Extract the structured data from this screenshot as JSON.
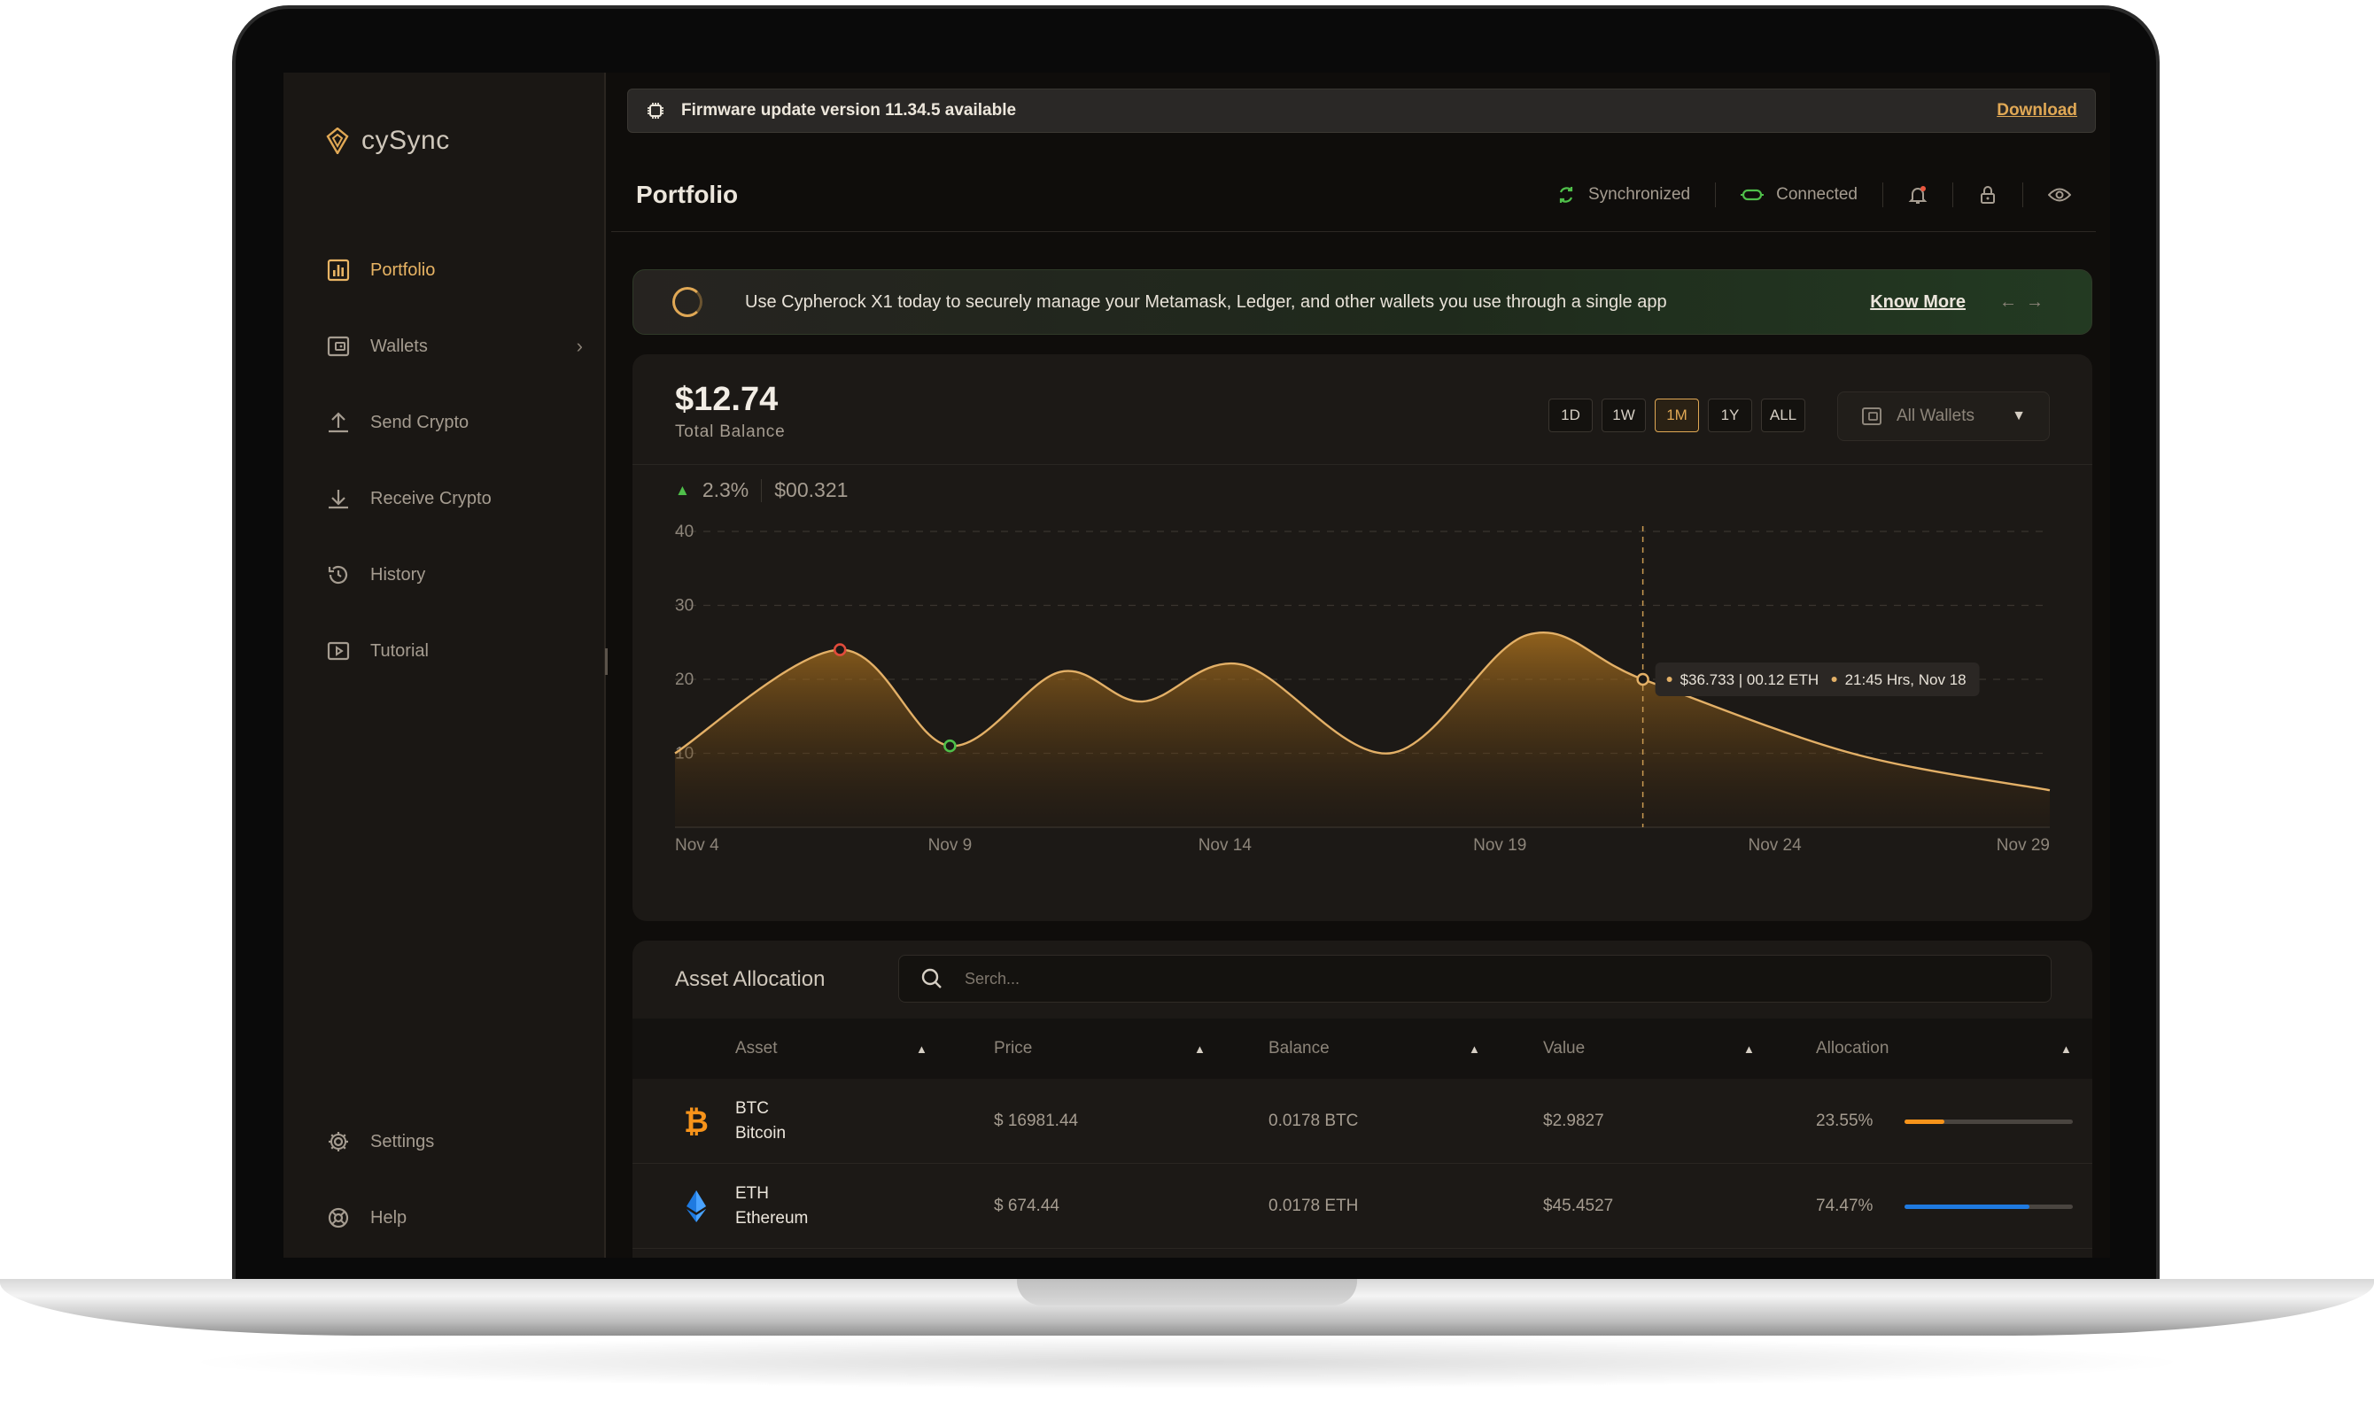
{
  "app": {
    "name": "cySync"
  },
  "sidebar": {
    "items": [
      {
        "label": "Portfolio",
        "icon": "portfolio-icon",
        "active": true
      },
      {
        "label": "Wallets",
        "icon": "wallet-icon",
        "has_submenu": true
      },
      {
        "label": "Send Crypto",
        "icon": "send-icon"
      },
      {
        "label": "Receive Crypto",
        "icon": "receive-icon"
      },
      {
        "label": "History",
        "icon": "history-icon"
      },
      {
        "label": "Tutorial",
        "icon": "tutorial-icon"
      }
    ],
    "bottom": [
      {
        "label": "Settings",
        "icon": "gear-icon"
      },
      {
        "label": "Help",
        "icon": "help-icon"
      }
    ]
  },
  "firmware": {
    "message": "Firmware update version 11.34.5 available",
    "action": "Download"
  },
  "header": {
    "title": "Portfolio",
    "sync_status": "Synchronized",
    "connection_status": "Connected"
  },
  "promo": {
    "text": "Use Cypherock X1 today to securely manage your Metamask, Ledger, and other wallets you use through a single app",
    "link": "Know More"
  },
  "balance": {
    "amount": "$12.74",
    "label": "Total Balance",
    "change_percent": "2.3%",
    "change_value": "$00.321"
  },
  "ranges": {
    "options": [
      "1D",
      "1W",
      "1M",
      "1Y",
      "ALL"
    ],
    "selected": "1M"
  },
  "wallet_filter": {
    "selected": "All Wallets"
  },
  "chart_data": {
    "type": "area",
    "x_tick_labels": [
      "Nov 4",
      "Nov 9",
      "Nov 14",
      "Nov 19",
      "Nov 24",
      "Nov 29"
    ],
    "y_tick_labels": [
      "10",
      "20",
      "30",
      "40"
    ],
    "x": [
      4,
      7,
      9,
      11,
      12.5,
      14.3,
      17,
      19.5,
      21.6,
      25.4,
      29
    ],
    "y": [
      10,
      24,
      11,
      21,
      17,
      22,
      10,
      26,
      20,
      10,
      5
    ],
    "xlim": [
      4,
      29
    ],
    "ylim": [
      0,
      40
    ],
    "grid": true,
    "markers": [
      {
        "x": 7,
        "y": 24,
        "color": "#e14b3b"
      },
      {
        "x": 9,
        "y": 11,
        "color": "#4fbf4a"
      }
    ],
    "tooltip": {
      "x": 21.6,
      "y": 20,
      "value": "$36.733 | 00.12 ETH",
      "time": "21:45 Hrs,  Nov 18"
    }
  },
  "assets": {
    "title": "Asset Allocation",
    "search_placeholder": "Serch...",
    "columns": [
      "Asset",
      "Price",
      "Balance",
      "Value",
      "Allocation"
    ],
    "rows": [
      {
        "symbol": "BTC",
        "name": "Bitcoin",
        "price": "$ 16981.44",
        "balance": "0.0178 BTC",
        "value": "$2.9827",
        "allocation": "23.55%",
        "allocation_fraction": 0.2355,
        "color": "#f7931a",
        "icon": "bitcoin-icon"
      },
      {
        "symbol": "ETH",
        "name": "Ethereum",
        "price": "$ 674.44",
        "balance": "0.0178 ETH",
        "value": "$45.4527",
        "allocation": "74.47%",
        "allocation_fraction": 0.7447,
        "color": "#1f7ae0",
        "icon": "ethereum-icon"
      }
    ]
  },
  "colors": {
    "accent": "#e0a855",
    "background": "#0f0d0b",
    "positive": "#4fbf4a"
  }
}
